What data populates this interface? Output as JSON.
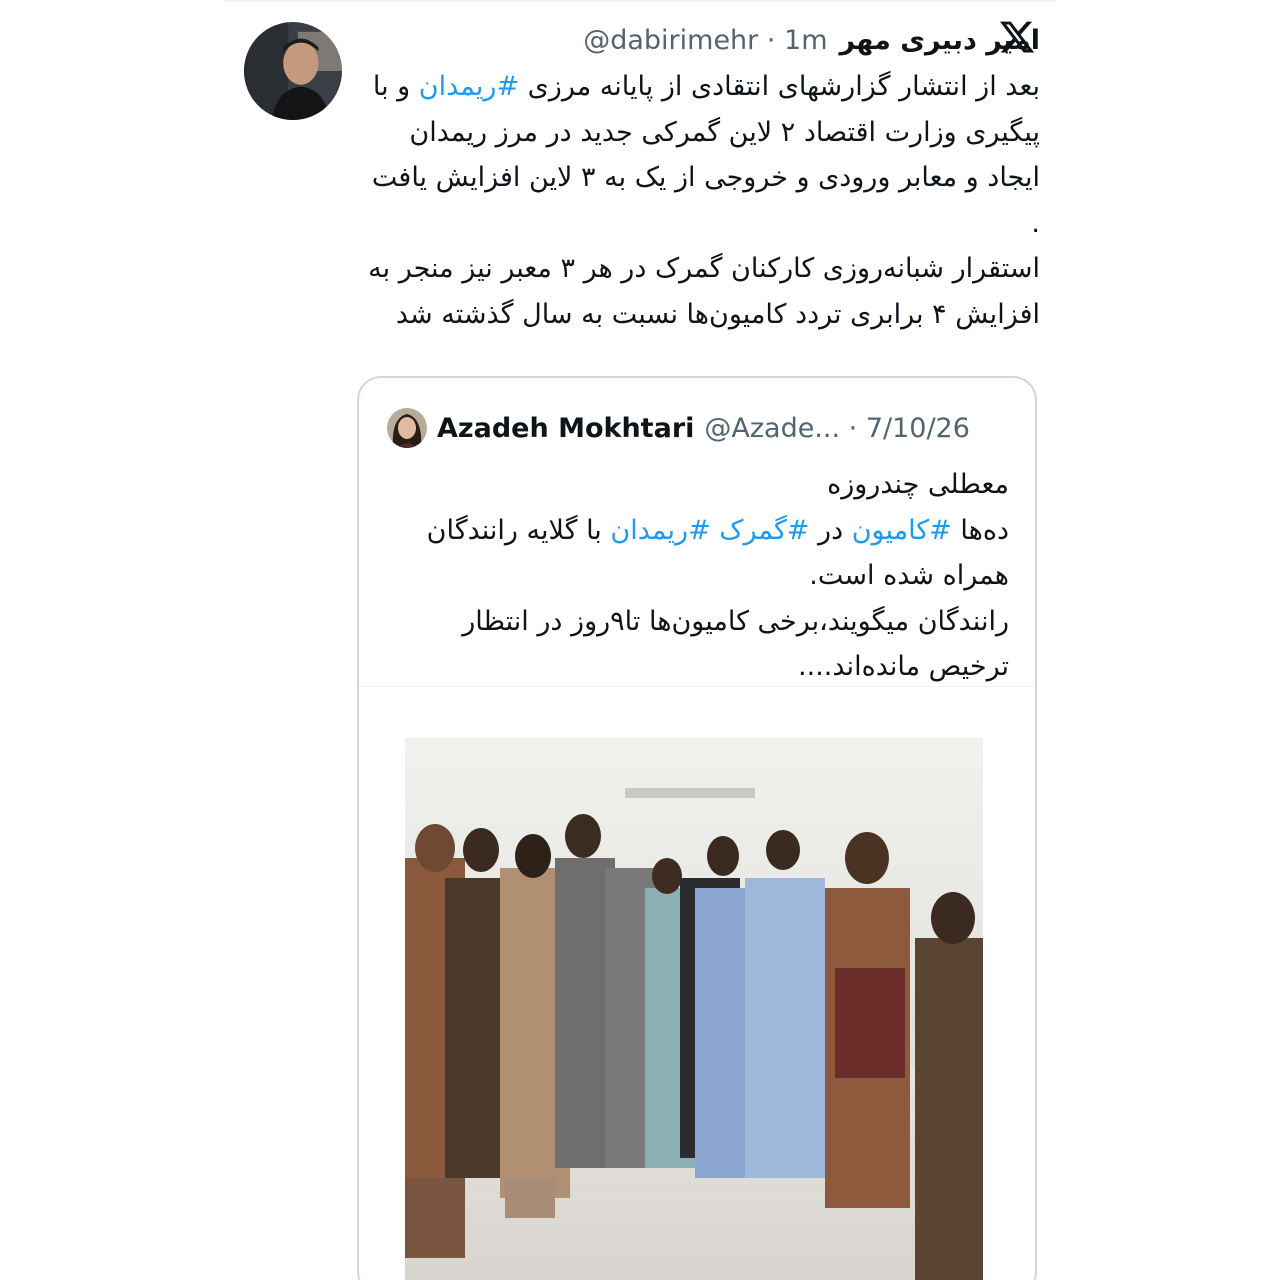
{
  "tweet": {
    "author": {
      "display_name": "امیر دبیری مهر",
      "handle": "@dabirimehr",
      "time": "1m"
    },
    "body": {
      "line1_prefix": "بعد از انتشار گزارشهای انتقادی از پایانه مرزی ",
      "hashtag_rimdan": "#ریمدان",
      "line1_suffix": " و با پیگیری وزارت اقتصاد ۲ لاین گمرکی جدید در مرز ریمدان ایجاد و معابر ورودی و خروجی از یک به ۳ لاین افزایش یافت .",
      "paragraph2": "استقرار شبانه‌روزی کارکنان گمرک در هر ۳ معبر نیز منجر به افزایش ۴ برابری تردد کامیون‌ها نسبت به سال گذشته شد"
    }
  },
  "quoted_tweet": {
    "author": {
      "display_name": "Azadeh Mokhtari",
      "handle": "@Azade...",
      "date": "7/10/26"
    },
    "body": {
      "line1": "معطلی چندروزه",
      "part_a": "ده‌ها ",
      "hashtag_truck": "#کامیون",
      "part_b": " در ",
      "hashtag_customs": "#گمرک",
      "part_c": " ",
      "hashtag_rimdan": "#ریمدان",
      "part_d": " با گلایه رانندگان همراه شده است.",
      "paragraph2": "رانندگان میگویند،برخی کامیون‌ها تا۹روز در انتظار ترخیص مانده‌اند...."
    }
  },
  "icons": {
    "x_logo": "x-logo-icon"
  },
  "colors": {
    "text": "#0f1419",
    "secondary": "#536471",
    "hashtag": "#1d9bf0",
    "border": "#cfd9de"
  }
}
